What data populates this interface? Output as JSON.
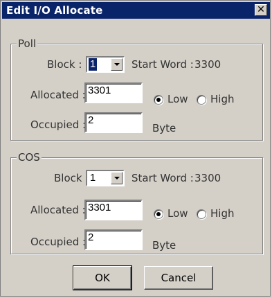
{
  "window": {
    "title": "Edit I/O Allocate",
    "close_label": "✕"
  },
  "poll": {
    "group_label": "Poll",
    "block_label": "Block :",
    "block_value": "1",
    "start_word_label": "Start Word :",
    "start_word_value": "3300",
    "allocated_label": "Allocated :",
    "allocated_value": "3301",
    "low_label": "Low",
    "high_label": "High",
    "occupied_label": "Occupied :",
    "occupied_value": "2",
    "unit_label": "Byte"
  },
  "cos": {
    "group_label": "COS",
    "block_label": "Block",
    "block_value": "1",
    "start_word_label": "Start Word :",
    "start_word_value": "3300",
    "allocated_label": "Allocated :",
    "allocated_value": "3301",
    "low_label": "Low",
    "high_label": "High",
    "occupied_label": "Occupied :",
    "occupied_value": "2",
    "unit_label": "Byte"
  },
  "buttons": {
    "ok": "OK",
    "cancel": "Cancel"
  },
  "colors": {
    "title_bar": "#0a246a",
    "dialog_bg": "#d4d0c8"
  }
}
